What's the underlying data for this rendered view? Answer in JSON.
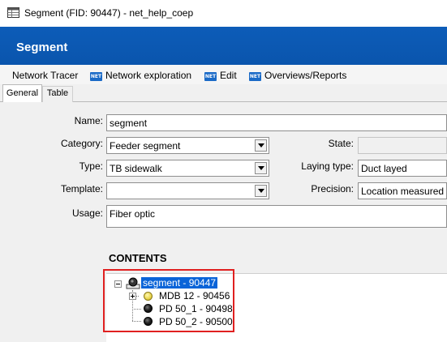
{
  "window": {
    "title": "Segment (FID: 90447) - net_help_coep"
  },
  "header": {
    "title": "Segment"
  },
  "menu": [
    {
      "label": "Network Tracer",
      "icon": ""
    },
    {
      "label": "Network exploration",
      "icon": "net-badge-icon"
    },
    {
      "label": "Edit",
      "icon": "net-badge-icon"
    },
    {
      "label": "Overviews/Reports",
      "icon": "net-badge-icon"
    }
  ],
  "menu_badge_text": "NET",
  "tabs": [
    {
      "label": "General",
      "active": true
    },
    {
      "label": "Table",
      "active": false
    }
  ],
  "form": {
    "name": {
      "label": "Name:",
      "value": "segment"
    },
    "category": {
      "label": "Category:",
      "value": "Feeder segment"
    },
    "type": {
      "label": "Type:",
      "value": "TB sidewalk"
    },
    "template": {
      "label": "Template:",
      "value": ""
    },
    "usage": {
      "label": "Usage:",
      "value": "Fiber optic"
    },
    "state": {
      "label": "State:",
      "value": ""
    },
    "laying_type": {
      "label": "Laying type:",
      "value": "Duct layed"
    },
    "precision": {
      "label": "Precision:",
      "value": "Location measured"
    }
  },
  "contents": {
    "title": "CONTENTS",
    "tree": {
      "root": {
        "label": "segment - 90447",
        "icon": "segment-icon",
        "expanded": true,
        "selected": true
      },
      "children": [
        {
          "label": "MDB 12 - 90456",
          "icon": "yellow-dot-icon",
          "expandable": true
        },
        {
          "label": "PD 50_1 - 90498",
          "icon": "black-dot-icon",
          "expandable": false
        },
        {
          "label": "PD 50_2 - 90500",
          "icon": "black-dot-icon",
          "expandable": false
        }
      ]
    }
  },
  "colors": {
    "header_blue": "#0d5cb8",
    "selection": "#0a64d8",
    "highlight": "#e02020"
  }
}
